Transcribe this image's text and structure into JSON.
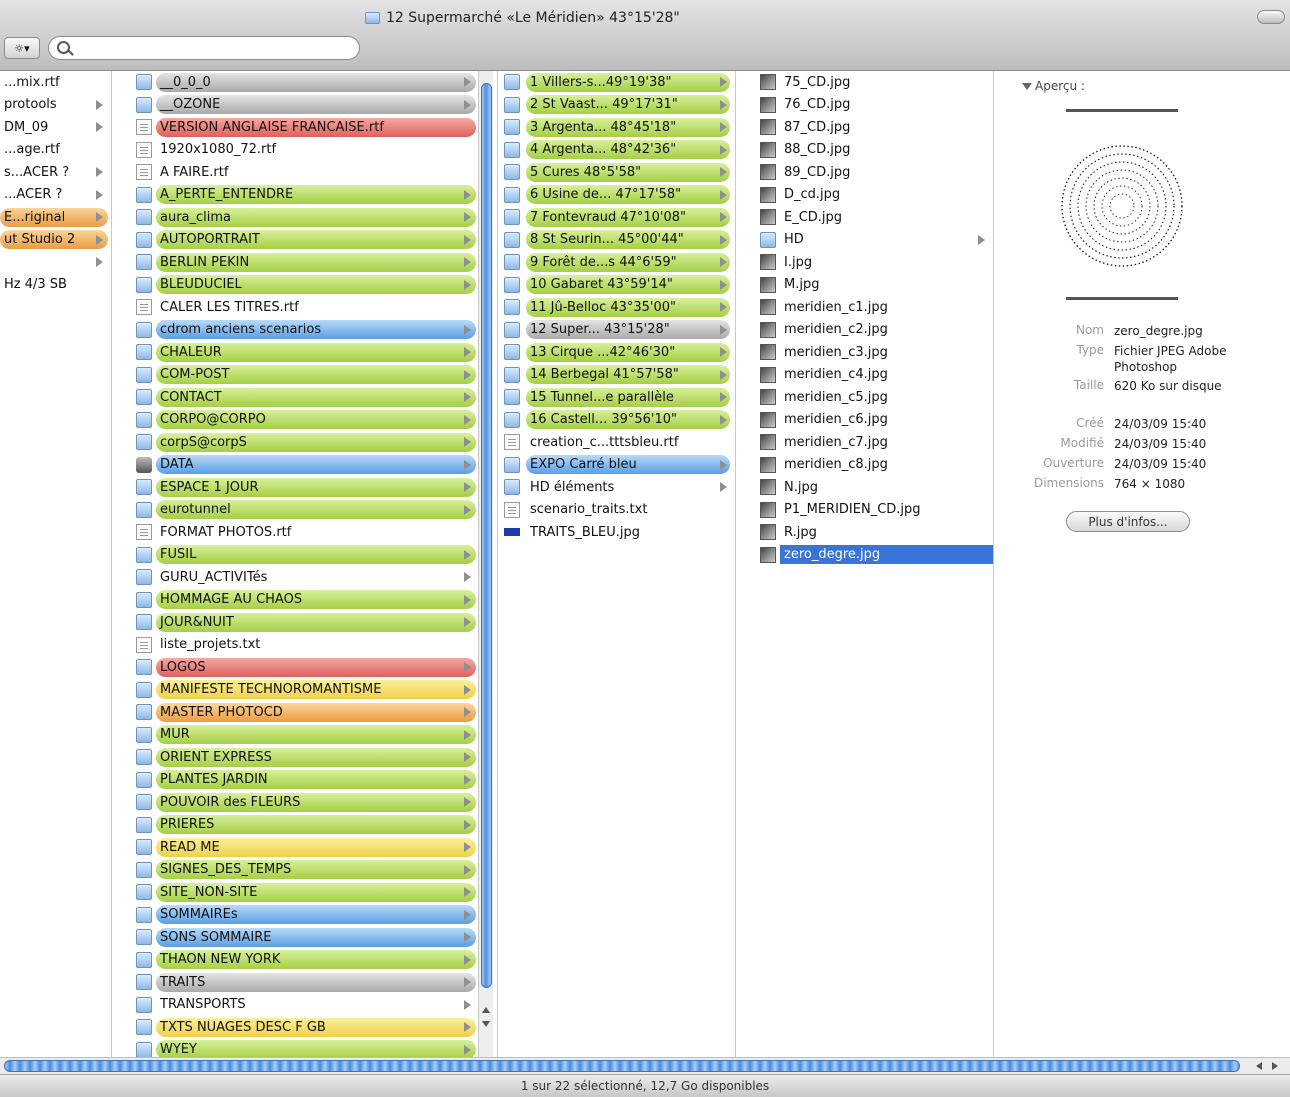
{
  "window": {
    "title": "12 Supermarché «Le Méridien» 43°15'28\"",
    "action_button": "☼▾",
    "search_placeholder": ""
  },
  "columns": [
    {
      "items": [
        {
          "label": "...mix.rtf",
          "arrow": false,
          "color": "none"
        },
        {
          "label": "protools",
          "arrow": true,
          "color": "none"
        },
        {
          "label": "DM_09",
          "arrow": true,
          "color": "none"
        },
        {
          "label": "...age.rtf",
          "arrow": false,
          "color": "none"
        },
        {
          "label": "s...ACER ?",
          "arrow": true,
          "color": "none"
        },
        {
          "label": "...ACER ?",
          "arrow": true,
          "color": "none"
        },
        {
          "label": "E...riginal",
          "arrow": true,
          "color": "orange"
        },
        {
          "label": "ut Studio 2",
          "arrow": true,
          "color": "orange"
        },
        {
          "label": "",
          "arrow": true,
          "color": "none"
        },
        {
          "label": "Hz 4/3 SB",
          "arrow": false,
          "color": "none"
        }
      ]
    },
    {
      "items": [
        {
          "label": "__0_0_0",
          "type": "folder",
          "arrow": true,
          "color": "gray"
        },
        {
          "label": "__OZONE",
          "type": "folder",
          "arrow": true,
          "color": "gray"
        },
        {
          "label": "VERSION ANGLAISE FRANCAISE.rtf",
          "type": "file",
          "arrow": false,
          "color": "red"
        },
        {
          "label": "1920x1080_72.rtf",
          "type": "file",
          "arrow": false,
          "color": "none"
        },
        {
          "label": "A FAIRE.rtf",
          "type": "file",
          "arrow": false,
          "color": "none"
        },
        {
          "label": "A_PERTE_ENTENDRE",
          "type": "folder",
          "arrow": true,
          "color": "green"
        },
        {
          "label": "aura_clima",
          "type": "folder",
          "arrow": true,
          "color": "green"
        },
        {
          "label": "AUTOPORTRAIT",
          "type": "folder",
          "arrow": true,
          "color": "green"
        },
        {
          "label": "BERLIN PEKIN",
          "type": "folder",
          "arrow": true,
          "color": "green"
        },
        {
          "label": "BLEUDUCIEL",
          "type": "folder",
          "arrow": true,
          "color": "green"
        },
        {
          "label": "CALER LES TITRES.rtf",
          "type": "file",
          "arrow": false,
          "color": "none"
        },
        {
          "label": "cdrom anciens scenarios",
          "type": "folder",
          "arrow": true,
          "color": "blue"
        },
        {
          "label": "CHALEUR",
          "type": "folder",
          "arrow": true,
          "color": "green"
        },
        {
          "label": "COM-POST",
          "type": "folder",
          "arrow": true,
          "color": "green"
        },
        {
          "label": "CONTACT",
          "type": "folder",
          "arrow": true,
          "color": "green"
        },
        {
          "label": "CORPO@CORPO",
          "type": "folder",
          "arrow": true,
          "color": "green"
        },
        {
          "label": "corpS@corpS",
          "type": "folder",
          "arrow": true,
          "color": "green"
        },
        {
          "label": "DATA",
          "type": "drive",
          "arrow": true,
          "color": "blue"
        },
        {
          "label": "ESPACE 1 JOUR",
          "type": "folder",
          "arrow": true,
          "color": "green"
        },
        {
          "label": "eurotunnel",
          "type": "folder",
          "arrow": true,
          "color": "green"
        },
        {
          "label": "FORMAT PHOTOS.rtf",
          "type": "file",
          "arrow": false,
          "color": "none"
        },
        {
          "label": "FUSIL",
          "type": "folder",
          "arrow": true,
          "color": "green"
        },
        {
          "label": "GURU_ACTIVITés",
          "type": "folder",
          "arrow": true,
          "color": "none"
        },
        {
          "label": "HOMMAGE AU CHAOS",
          "type": "folder",
          "arrow": true,
          "color": "green"
        },
        {
          "label": "JOUR&NUIT",
          "type": "folder",
          "arrow": true,
          "color": "green"
        },
        {
          "label": "liste_projets.txt",
          "type": "file",
          "arrow": false,
          "color": "none"
        },
        {
          "label": "LOGOS",
          "type": "folder",
          "arrow": true,
          "color": "red"
        },
        {
          "label": "MANIFESTE TECHNOROMANTISME",
          "type": "folder",
          "arrow": true,
          "color": "yellow"
        },
        {
          "label": "MASTER PHOTOCD",
          "type": "folder",
          "arrow": true,
          "color": "orange"
        },
        {
          "label": "MUR",
          "type": "folder",
          "arrow": true,
          "color": "green"
        },
        {
          "label": "ORIENT EXPRESS",
          "type": "folder",
          "arrow": true,
          "color": "green"
        },
        {
          "label": "PLANTES JARDIN",
          "type": "folder",
          "arrow": true,
          "color": "green"
        },
        {
          "label": "POUVOIR des FLEURS",
          "type": "folder",
          "arrow": true,
          "color": "green"
        },
        {
          "label": "PRIERES",
          "type": "folder",
          "arrow": true,
          "color": "green"
        },
        {
          "label": "READ ME",
          "type": "folder",
          "arrow": true,
          "color": "yellow"
        },
        {
          "label": "SIGNES_DES_TEMPS",
          "type": "folder",
          "arrow": true,
          "color": "green"
        },
        {
          "label": "SITE_NON-SITE",
          "type": "folder",
          "arrow": true,
          "color": "green"
        },
        {
          "label": "SOMMAIREs",
          "type": "folder",
          "arrow": true,
          "color": "blue"
        },
        {
          "label": "SONS SOMMAIRE",
          "type": "folder",
          "arrow": true,
          "color": "blue"
        },
        {
          "label": "THAON NEW YORK",
          "type": "folder",
          "arrow": true,
          "color": "green"
        },
        {
          "label": "TRAITS",
          "type": "folder",
          "arrow": true,
          "color": "gray"
        },
        {
          "label": "TRANSPORTS",
          "type": "folder",
          "arrow": true,
          "color": "none"
        },
        {
          "label": "TXTS NUAGES DESC F GB",
          "type": "folder",
          "arrow": true,
          "color": "yellow"
        },
        {
          "label": "WYEY",
          "type": "folder",
          "arrow": true,
          "color": "green"
        }
      ]
    },
    {
      "items": [
        {
          "label": "1 Villers-s...49°19'38\"",
          "type": "folder",
          "arrow": true,
          "color": "green"
        },
        {
          "label": "2 St Vaast... 49°17'31\"",
          "type": "folder",
          "arrow": true,
          "color": "green"
        },
        {
          "label": "3 Argenta... 48°45'18\"",
          "type": "folder",
          "arrow": true,
          "color": "green"
        },
        {
          "label": "4 Argenta... 48°42'36\"",
          "type": "folder",
          "arrow": true,
          "color": "green"
        },
        {
          "label": "5 Cures 48°5'58\"",
          "type": "folder",
          "arrow": true,
          "color": "green"
        },
        {
          "label": "6 Usine de... 47°17'58\"",
          "type": "folder",
          "arrow": true,
          "color": "green"
        },
        {
          "label": "7 Fontevraud 47°10'08\"",
          "type": "folder",
          "arrow": true,
          "color": "green"
        },
        {
          "label": "8 St Seurin... 45°00'44\"",
          "type": "folder",
          "arrow": true,
          "color": "green"
        },
        {
          "label": "9 Forêt de...s 44°6'59\"",
          "type": "folder",
          "arrow": true,
          "color": "green"
        },
        {
          "label": "10 Gabaret 43°59'14\"",
          "type": "folder",
          "arrow": true,
          "color": "green"
        },
        {
          "label": "11 Jû-Belloc 43°35'00\"",
          "type": "folder",
          "arrow": true,
          "color": "green"
        },
        {
          "label": "12 Super... 43°15'28\"",
          "type": "folder",
          "arrow": true,
          "color": "gray"
        },
        {
          "label": "13 Cirque ...42°46'30\"",
          "type": "folder",
          "arrow": true,
          "color": "green"
        },
        {
          "label": "14 Berbegal 41°57'58\"",
          "type": "folder",
          "arrow": true,
          "color": "green"
        },
        {
          "label": "15 Tunnel...e parallèle",
          "type": "folder",
          "arrow": true,
          "color": "green"
        },
        {
          "label": "16 Castell... 39°56'10\"",
          "type": "folder",
          "arrow": true,
          "color": "green"
        },
        {
          "label": "creation_c...tttsbleu.rtf",
          "type": "file",
          "arrow": false,
          "color": "none"
        },
        {
          "label": "EXPO Carré bleu",
          "type": "folder",
          "arrow": true,
          "color": "blue"
        },
        {
          "label": "HD éléments",
          "type": "folder",
          "arrow": true,
          "color": "none"
        },
        {
          "label": "scenario_traits.txt",
          "type": "file",
          "arrow": false,
          "color": "none"
        },
        {
          "label": "TRAITS_BLEU.jpg",
          "type": "bar",
          "arrow": false,
          "color": "none"
        }
      ]
    },
    {
      "items": [
        {
          "label": "75_CD.jpg",
          "type": "image",
          "arrow": false,
          "color": "none"
        },
        {
          "label": "76_CD.jpg",
          "type": "image",
          "arrow": false,
          "color": "none"
        },
        {
          "label": "87_CD.jpg",
          "type": "image",
          "arrow": false,
          "color": "none"
        },
        {
          "label": "88_CD.jpg",
          "type": "image",
          "arrow": false,
          "color": "none"
        },
        {
          "label": "89_CD.jpg",
          "type": "image",
          "arrow": false,
          "color": "none"
        },
        {
          "label": "D_cd.jpg",
          "type": "image",
          "arrow": false,
          "color": "none"
        },
        {
          "label": "E_CD.jpg",
          "type": "image",
          "arrow": false,
          "color": "none"
        },
        {
          "label": "HD",
          "type": "folder",
          "arrow": true,
          "color": "none"
        },
        {
          "label": "I.jpg",
          "type": "image",
          "arrow": false,
          "color": "none"
        },
        {
          "label": "M.jpg",
          "type": "image",
          "arrow": false,
          "color": "none"
        },
        {
          "label": "meridien_c1.jpg",
          "type": "image",
          "arrow": false,
          "color": "none"
        },
        {
          "label": "meridien_c2.jpg",
          "type": "image",
          "arrow": false,
          "color": "none"
        },
        {
          "label": "meridien_c3.jpg",
          "type": "image",
          "arrow": false,
          "color": "none"
        },
        {
          "label": "meridien_c4.jpg",
          "type": "image",
          "arrow": false,
          "color": "none"
        },
        {
          "label": "meridien_c5.jpg",
          "type": "image",
          "arrow": false,
          "color": "none"
        },
        {
          "label": "meridien_c6.jpg",
          "type": "image",
          "arrow": false,
          "color": "none"
        },
        {
          "label": "meridien_c7.jpg",
          "type": "image",
          "arrow": false,
          "color": "none"
        },
        {
          "label": "meridien_c8.jpg",
          "type": "image",
          "arrow": false,
          "color": "none"
        },
        {
          "label": "N.jpg",
          "type": "image",
          "arrow": false,
          "color": "none"
        },
        {
          "label": "P1_MERIDIEN_CD.jpg",
          "type": "image",
          "arrow": false,
          "color": "none"
        },
        {
          "label": "R.jpg",
          "type": "image",
          "arrow": false,
          "color": "none"
        },
        {
          "label": "zero_degre.jpg",
          "type": "image",
          "arrow": false,
          "color": "selected"
        }
      ]
    }
  ],
  "preview": {
    "title": "Aperçu :",
    "fields": [
      {
        "key": "Nom",
        "value": "zero_degre.jpg"
      },
      {
        "key": "Type",
        "value": "Fichier JPEG Adobe Photoshop"
      },
      {
        "key": "Taille",
        "value": "620 Ko sur disque"
      },
      {
        "key": "Créé",
        "value": "24/03/09 15:40"
      },
      {
        "key": "Modifié",
        "value": "24/03/09 15:40"
      },
      {
        "key": "Ouverture",
        "value": "24/03/09 15:40"
      },
      {
        "key": "Dimensions",
        "value": "764 × 1080"
      }
    ],
    "more_info_label": "Plus d'infos..."
  },
  "status_bar": "1 sur 22 sélectionné, 12,7 Go disponibles",
  "colors": {
    "label_green": "#b6dc5a",
    "label_gray": "#b9b9b9",
    "label_red": "#e9706a",
    "label_blue": "#6aa9ea",
    "label_yellow": "#f2da5c",
    "label_orange": "#f0a64f",
    "selection": "#3875d7"
  }
}
